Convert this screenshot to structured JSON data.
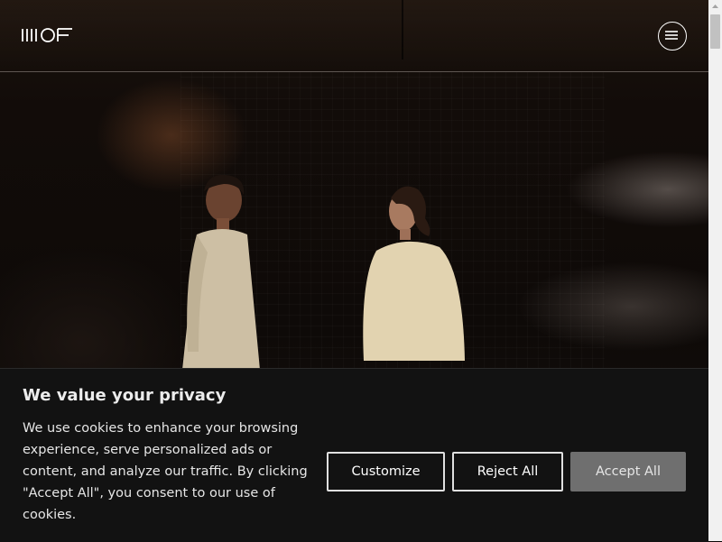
{
  "header": {
    "logo_alt": "MOF",
    "menu_icon": "hamburger-icon"
  },
  "cookie_banner": {
    "title": "We value your privacy",
    "text": "We use cookies to enhance your browsing experience, serve personalized ads or content, and analyze our traffic. By clicking \"Accept All\", you consent to our use of cookies.",
    "buttons": {
      "customize": "Customize",
      "reject": "Reject All",
      "accept": "Accept All"
    }
  },
  "colors": {
    "banner_bg": "#121212",
    "accept_bg": "#6f6f6f",
    "text": "#ffffff"
  }
}
